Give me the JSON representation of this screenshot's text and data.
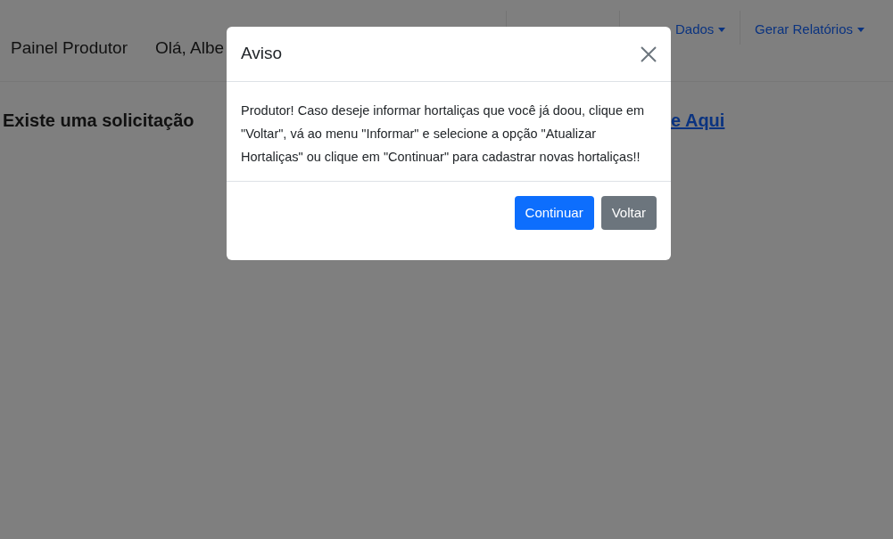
{
  "navbar": {
    "brand": "Painel Produtor",
    "greeting": "Olá, Albe",
    "links": [
      {
        "label": "Dados",
        "has_dropdown": true
      },
      {
        "label": "Gerar Relatórios",
        "has_dropdown": true
      }
    ]
  },
  "notice": {
    "text": "Existe uma solicitação",
    "link": "e Aqui"
  },
  "modal": {
    "title": "Aviso",
    "body": "Produtor! Caso deseje informar hortaliças que você já doou, clique em \"Voltar\", vá ao menu \"Informar\" e selecione a opção \"Atualizar Hortaliças\" ou clique em \"Continuar\" para cadastrar novas hortaliças!!",
    "buttons": [
      {
        "label": "Continuar",
        "kind": "primary"
      },
      {
        "label": "Voltar",
        "kind": "secondary"
      }
    ]
  }
}
